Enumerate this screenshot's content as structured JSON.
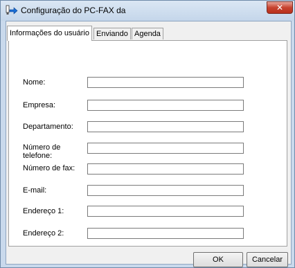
{
  "window": {
    "title": "Configuração do PC-FAX da",
    "close_glyph": "✕"
  },
  "tabs": [
    {
      "label": "Informações do usuário",
      "active": true
    },
    {
      "label": "Enviando",
      "active": false
    },
    {
      "label": "Agenda",
      "active": false
    }
  ],
  "fields": [
    {
      "label": "Nome:",
      "value": ""
    },
    {
      "label": "Empresa:",
      "value": ""
    },
    {
      "label": "Departamento:",
      "value": ""
    },
    {
      "label": "Número de\ntelefone:",
      "value": ""
    },
    {
      "label": "Número de fax:",
      "value": ""
    },
    {
      "label": "E-mail:",
      "value": ""
    },
    {
      "label": "Endereço 1:",
      "value": ""
    },
    {
      "label": "Endereço 2:",
      "value": ""
    }
  ],
  "buttons": {
    "ok": "OK",
    "cancel": "Cancelar"
  },
  "icons": {
    "app": "pc-fax-icon",
    "close": "close-icon"
  }
}
